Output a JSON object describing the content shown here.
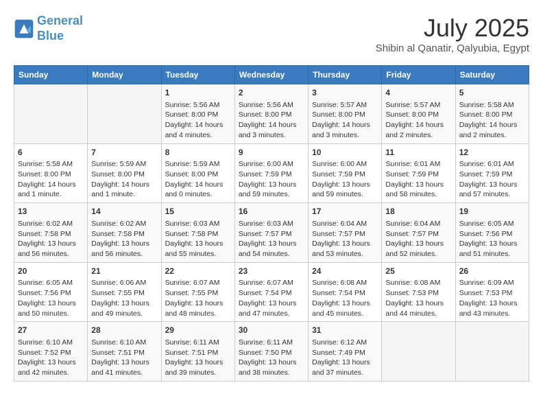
{
  "header": {
    "logo_line1": "General",
    "logo_line2": "Blue",
    "month": "July 2025",
    "location": "Shibin al Qanatir, Qalyubia, Egypt"
  },
  "weekdays": [
    "Sunday",
    "Monday",
    "Tuesday",
    "Wednesday",
    "Thursday",
    "Friday",
    "Saturday"
  ],
  "weeks": [
    [
      {
        "day": "",
        "info": ""
      },
      {
        "day": "",
        "info": ""
      },
      {
        "day": "1",
        "info": "Sunrise: 5:56 AM\nSunset: 8:00 PM\nDaylight: 14 hours and 4 minutes."
      },
      {
        "day": "2",
        "info": "Sunrise: 5:56 AM\nSunset: 8:00 PM\nDaylight: 14 hours and 3 minutes."
      },
      {
        "day": "3",
        "info": "Sunrise: 5:57 AM\nSunset: 8:00 PM\nDaylight: 14 hours and 3 minutes."
      },
      {
        "day": "4",
        "info": "Sunrise: 5:57 AM\nSunset: 8:00 PM\nDaylight: 14 hours and 2 minutes."
      },
      {
        "day": "5",
        "info": "Sunrise: 5:58 AM\nSunset: 8:00 PM\nDaylight: 14 hours and 2 minutes."
      }
    ],
    [
      {
        "day": "6",
        "info": "Sunrise: 5:58 AM\nSunset: 8:00 PM\nDaylight: 14 hours and 1 minute."
      },
      {
        "day": "7",
        "info": "Sunrise: 5:59 AM\nSunset: 8:00 PM\nDaylight: 14 hours and 1 minute."
      },
      {
        "day": "8",
        "info": "Sunrise: 5:59 AM\nSunset: 8:00 PM\nDaylight: 14 hours and 0 minutes."
      },
      {
        "day": "9",
        "info": "Sunrise: 6:00 AM\nSunset: 7:59 PM\nDaylight: 13 hours and 59 minutes."
      },
      {
        "day": "10",
        "info": "Sunrise: 6:00 AM\nSunset: 7:59 PM\nDaylight: 13 hours and 59 minutes."
      },
      {
        "day": "11",
        "info": "Sunrise: 6:01 AM\nSunset: 7:59 PM\nDaylight: 13 hours and 58 minutes."
      },
      {
        "day": "12",
        "info": "Sunrise: 6:01 AM\nSunset: 7:59 PM\nDaylight: 13 hours and 57 minutes."
      }
    ],
    [
      {
        "day": "13",
        "info": "Sunrise: 6:02 AM\nSunset: 7:58 PM\nDaylight: 13 hours and 56 minutes."
      },
      {
        "day": "14",
        "info": "Sunrise: 6:02 AM\nSunset: 7:58 PM\nDaylight: 13 hours and 56 minutes."
      },
      {
        "day": "15",
        "info": "Sunrise: 6:03 AM\nSunset: 7:58 PM\nDaylight: 13 hours and 55 minutes."
      },
      {
        "day": "16",
        "info": "Sunrise: 6:03 AM\nSunset: 7:57 PM\nDaylight: 13 hours and 54 minutes."
      },
      {
        "day": "17",
        "info": "Sunrise: 6:04 AM\nSunset: 7:57 PM\nDaylight: 13 hours and 53 minutes."
      },
      {
        "day": "18",
        "info": "Sunrise: 6:04 AM\nSunset: 7:57 PM\nDaylight: 13 hours and 52 minutes."
      },
      {
        "day": "19",
        "info": "Sunrise: 6:05 AM\nSunset: 7:56 PM\nDaylight: 13 hours and 51 minutes."
      }
    ],
    [
      {
        "day": "20",
        "info": "Sunrise: 6:05 AM\nSunset: 7:56 PM\nDaylight: 13 hours and 50 minutes."
      },
      {
        "day": "21",
        "info": "Sunrise: 6:06 AM\nSunset: 7:55 PM\nDaylight: 13 hours and 49 minutes."
      },
      {
        "day": "22",
        "info": "Sunrise: 6:07 AM\nSunset: 7:55 PM\nDaylight: 13 hours and 48 minutes."
      },
      {
        "day": "23",
        "info": "Sunrise: 6:07 AM\nSunset: 7:54 PM\nDaylight: 13 hours and 47 minutes."
      },
      {
        "day": "24",
        "info": "Sunrise: 6:08 AM\nSunset: 7:54 PM\nDaylight: 13 hours and 45 minutes."
      },
      {
        "day": "25",
        "info": "Sunrise: 6:08 AM\nSunset: 7:53 PM\nDaylight: 13 hours and 44 minutes."
      },
      {
        "day": "26",
        "info": "Sunrise: 6:09 AM\nSunset: 7:53 PM\nDaylight: 13 hours and 43 minutes."
      }
    ],
    [
      {
        "day": "27",
        "info": "Sunrise: 6:10 AM\nSunset: 7:52 PM\nDaylight: 13 hours and 42 minutes."
      },
      {
        "day": "28",
        "info": "Sunrise: 6:10 AM\nSunset: 7:51 PM\nDaylight: 13 hours and 41 minutes."
      },
      {
        "day": "29",
        "info": "Sunrise: 6:11 AM\nSunset: 7:51 PM\nDaylight: 13 hours and 39 minutes."
      },
      {
        "day": "30",
        "info": "Sunrise: 6:11 AM\nSunset: 7:50 PM\nDaylight: 13 hours and 38 minutes."
      },
      {
        "day": "31",
        "info": "Sunrise: 6:12 AM\nSunset: 7:49 PM\nDaylight: 13 hours and 37 minutes."
      },
      {
        "day": "",
        "info": ""
      },
      {
        "day": "",
        "info": ""
      }
    ]
  ]
}
